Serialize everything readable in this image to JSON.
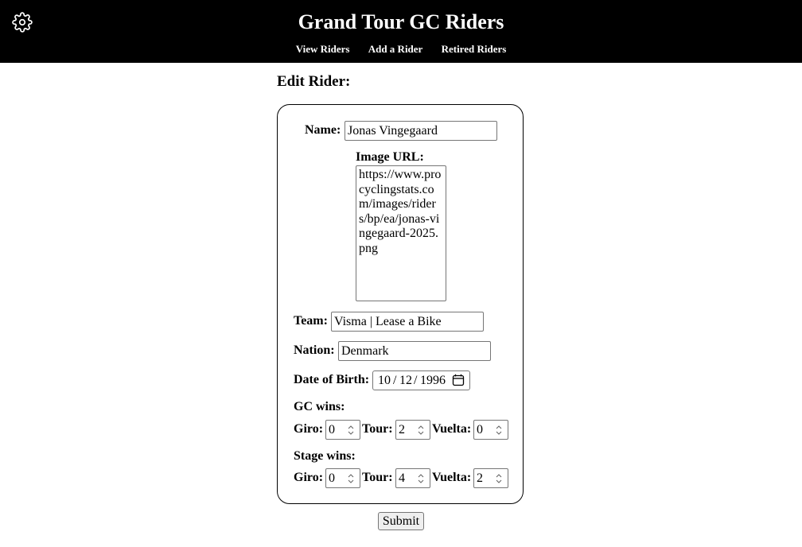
{
  "header": {
    "title": "Grand Tour GC Riders",
    "nav": [
      "View Riders",
      "Add a Rider",
      "Retired Riders"
    ]
  },
  "form": {
    "heading": "Edit Rider:",
    "name": {
      "label": "Name:",
      "value": "Jonas Vingegaard"
    },
    "image_url": {
      "label": "Image URL:",
      "value": "https://www.procyclingstats.com/images/riders/bp/ea/jonas-vingegaard-2025.png"
    },
    "team": {
      "label": "Team:",
      "value": "Visma | Lease a Bike"
    },
    "nation": {
      "label": "Nation:",
      "value": "Denmark"
    },
    "dob": {
      "label": "Date of Birth:",
      "month": "10",
      "day": "12",
      "year": "1996",
      "sep": "/"
    },
    "gc_wins": {
      "label": "GC wins:",
      "giro_label": "Giro:",
      "giro": "0",
      "tour_label": "Tour:",
      "tour": "2",
      "vuelta_label": "Vuelta:",
      "vuelta": "0"
    },
    "stage_wins": {
      "label": "Stage wins:",
      "giro_label": "Giro:",
      "giro": "0",
      "tour_label": "Tour:",
      "tour": "4",
      "vuelta_label": "Vuelta:",
      "vuelta": "2"
    },
    "submit_label": "Submit"
  },
  "icons": {
    "settings": "gear-icon",
    "calendar": "calendar-icon",
    "spinner": "spinner-icon"
  }
}
